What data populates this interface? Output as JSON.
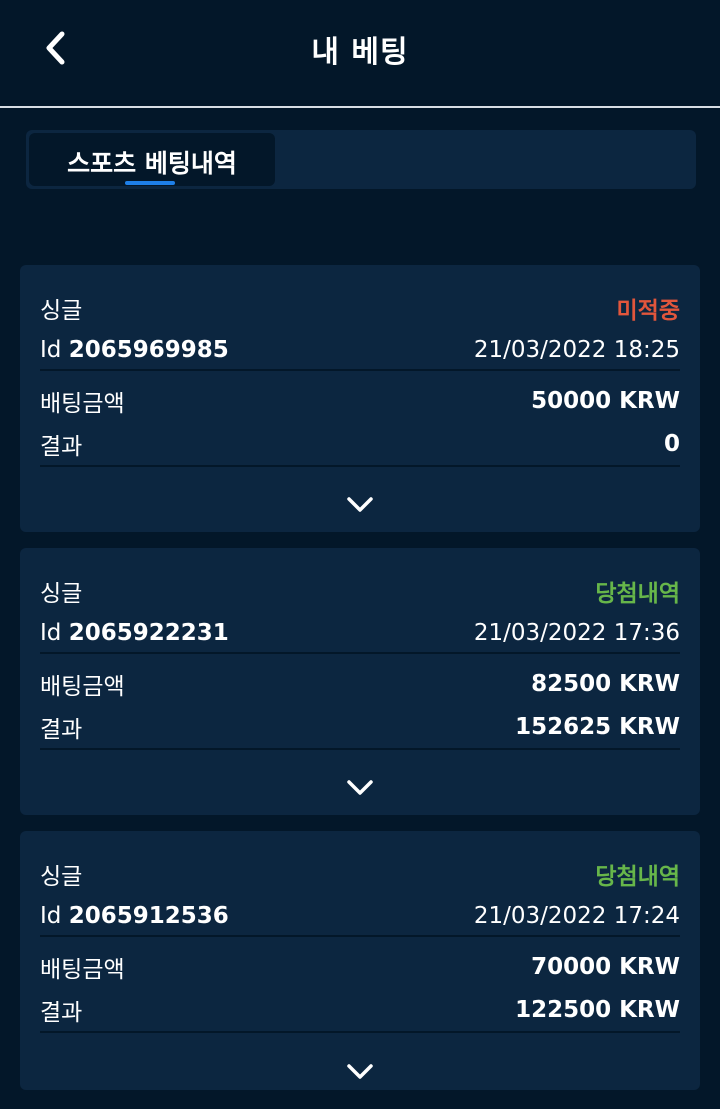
{
  "header": {
    "title": "내 베팅",
    "back_icon": "chevron-left-icon"
  },
  "tabs": [
    {
      "label": "스포츠 베팅내역",
      "active": true
    }
  ],
  "colors": {
    "accent": "#1e7fe8",
    "pending": "#e2563c",
    "won": "#67b64a",
    "card": "#0c2640",
    "background": "#031729"
  },
  "bets": [
    {
      "type": "싱글",
      "status": "미적중",
      "status_kind": "pending",
      "id_label": "Id",
      "id": "2065969985",
      "datetime": "21/03/2022 18:25",
      "amount_label": "배팅금액",
      "amount": "50000 KRW",
      "result_label": "결과",
      "result": "0"
    },
    {
      "type": "싱글",
      "status": "당첨내역",
      "status_kind": "won",
      "id_label": "Id",
      "id": "2065922231",
      "datetime": "21/03/2022 17:36",
      "amount_label": "배팅금액",
      "amount": "82500 KRW",
      "result_label": "결과",
      "result": "152625 KRW"
    },
    {
      "type": "싱글",
      "status": "당첨내역",
      "status_kind": "won",
      "id_label": "Id",
      "id": "2065912536",
      "datetime": "21/03/2022 17:24",
      "amount_label": "배팅금액",
      "amount": "70000 KRW",
      "result_label": "결과",
      "result": "122500 KRW"
    }
  ]
}
